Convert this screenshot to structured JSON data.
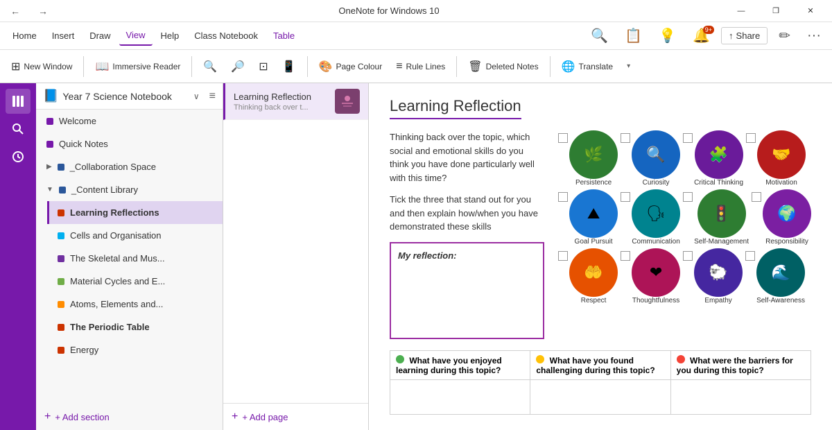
{
  "titlebar": {
    "app_title": "OneNote for Windows 10",
    "back_label": "←",
    "forward_label": "→",
    "min_label": "—",
    "max_label": "❐",
    "close_label": "✕"
  },
  "menu": {
    "items": [
      {
        "label": "Home",
        "active": false
      },
      {
        "label": "Insert",
        "active": false
      },
      {
        "label": "Draw",
        "active": false
      },
      {
        "label": "View",
        "active": true
      },
      {
        "label": "Help",
        "active": false
      },
      {
        "label": "Class Notebook",
        "active": false
      },
      {
        "label": "Table",
        "active": true
      }
    ],
    "right_icons": [
      "🔍",
      "📋",
      "💡"
    ],
    "notifications_label": "9+",
    "share_label": "Share",
    "edit_label": "✏",
    "more_label": "···"
  },
  "toolbar": {
    "items": [
      {
        "icon": "⊞",
        "label": "New Window"
      },
      {
        "icon": "📖",
        "label": "Immersive Reader"
      },
      {
        "icon": "🔍",
        "label": ""
      },
      {
        "icon": "🔎",
        "label": ""
      },
      {
        "icon": "⊡",
        "label": ""
      },
      {
        "icon": "📱",
        "label": ""
      },
      {
        "icon": "🎨",
        "label": "Page Colour"
      },
      {
        "icon": "≡",
        "label": "Rule Lines"
      },
      {
        "icon": "🗑",
        "label": "Deleted Notes"
      },
      {
        "icon": "🌐",
        "label": "Translate"
      },
      {
        "icon": "▾",
        "label": ""
      }
    ]
  },
  "notebook": {
    "icon": "📘",
    "title": "Year 7 Science Notebook",
    "chevron": "∨",
    "sort_icon": "≡"
  },
  "sections": [
    {
      "id": "welcome",
      "label": "Welcome",
      "color": "#7719aa",
      "indent": false,
      "chevron": false
    },
    {
      "id": "quick-notes",
      "label": "Quick Notes",
      "color": "#7719aa",
      "indent": false,
      "chevron": false
    },
    {
      "id": "collaboration",
      "label": "_Collaboration Space",
      "color": "#2B579A",
      "indent": false,
      "chevron": true,
      "collapsed": true
    },
    {
      "id": "content-library",
      "label": "_Content Library",
      "color": "#2B579A",
      "indent": false,
      "chevron": true,
      "collapsed": false
    },
    {
      "id": "learning-reflections",
      "label": "Learning Reflections",
      "color": "#CC3300",
      "indent": true,
      "active": true
    },
    {
      "id": "cells",
      "label": "Cells and Organisation",
      "color": "#00B0F0",
      "indent": true
    },
    {
      "id": "skeletal",
      "label": "The Skeletal and Mus...",
      "color": "#7030A0",
      "indent": true
    },
    {
      "id": "material",
      "label": "Material Cycles and E...",
      "color": "#70AD47",
      "indent": true
    },
    {
      "id": "atoms",
      "label": "Atoms, Elements and...",
      "color": "#FF8C00",
      "indent": true
    },
    {
      "id": "periodic",
      "label": "The Periodic Table",
      "color": "#CC3300",
      "indent": true,
      "bold": true
    },
    {
      "id": "energy",
      "label": "Energy",
      "color": "#CC3300",
      "indent": true
    }
  ],
  "add_section_label": "+ Add section",
  "pages": [
    {
      "id": "learning-reflection",
      "title": "Learning Reflection",
      "preview": "Thinking back over t...",
      "has_thumb": true,
      "thumb_color": "#7B3F6E",
      "active": true
    }
  ],
  "add_page_label": "+ Add page",
  "content": {
    "page_title": "Learning Reflection",
    "intro_text": "Thinking back over the topic, which social and emotional skills do you think you have done particularly well with this time?",
    "instruction_text": "Tick the three that stand out for you and then explain how/when you have demonstrated these skills",
    "reflection_box_label": "My reflection:",
    "skills": [
      {
        "label": "Persistence",
        "color": "#2E7D32",
        "icon": "🌿"
      },
      {
        "label": "Curiosity",
        "color": "#1565C0",
        "icon": "🔍"
      },
      {
        "label": "Critical Thinking",
        "color": "#6A1B9A",
        "icon": "🧩"
      },
      {
        "label": "Motivation",
        "color": "#B71C1C",
        "icon": "🤝"
      },
      {
        "label": "Goal Pursuit",
        "color": "#1976D2",
        "icon": "⛰"
      },
      {
        "label": "Communication",
        "color": "#00838F",
        "icon": "🗣"
      },
      {
        "label": "Self-Management",
        "color": "#2E7D32",
        "icon": "🚦"
      },
      {
        "label": "Responsibility",
        "color": "#7B1FA2",
        "icon": "🌍"
      },
      {
        "label": "Respect",
        "color": "#E65100",
        "icon": "🤲"
      },
      {
        "label": "Thoughtfulness",
        "color": "#AD1457",
        "icon": "❤"
      },
      {
        "label": "Empathy",
        "color": "#4527A0",
        "icon": "🐑"
      },
      {
        "label": "Self-Awareness",
        "color": "#006064",
        "icon": "🌊"
      }
    ],
    "table_headers": [
      {
        "dot": "green",
        "text": "What have you enjoyed learning during this topic?"
      },
      {
        "dot": "yellow",
        "text": "What have you found challenging during this topic?"
      },
      {
        "dot": "red",
        "text": "What were the barriers for you during this topic?"
      }
    ]
  },
  "sidebar_icons": [
    {
      "icon": "📚",
      "name": "notebooks-icon"
    },
    {
      "icon": "🔍",
      "name": "search-icon"
    },
    {
      "icon": "🕐",
      "name": "recent-icon"
    }
  ]
}
